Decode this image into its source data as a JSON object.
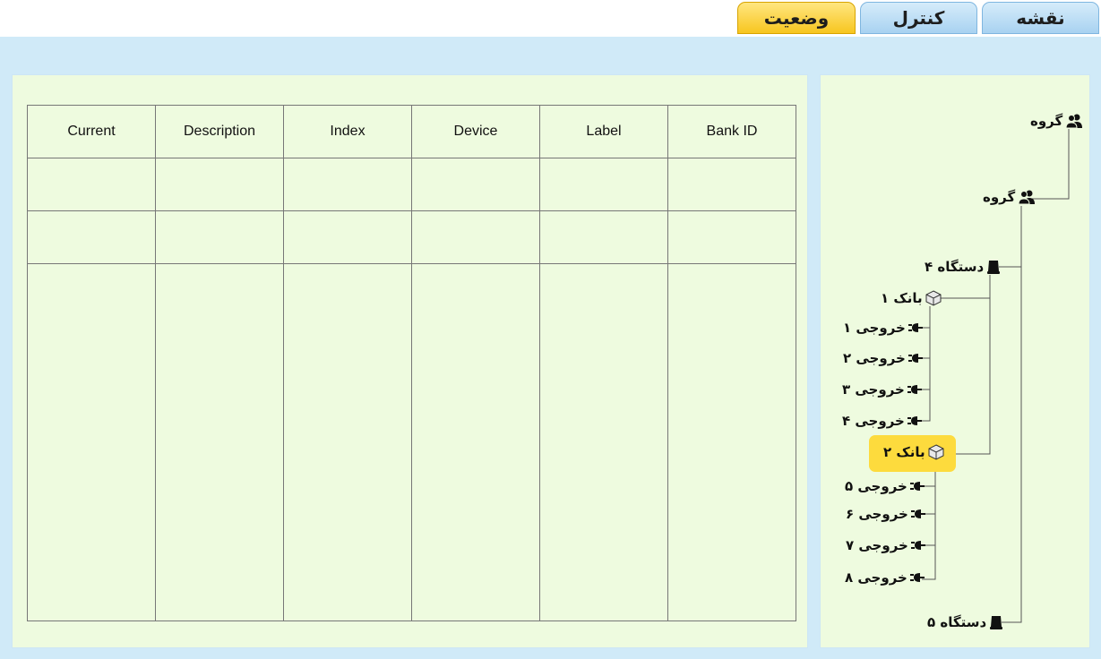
{
  "tabs": [
    {
      "label": "نقشه",
      "active": false
    },
    {
      "label": "کنترل",
      "active": false
    },
    {
      "label": "وضعیت",
      "active": true
    }
  ],
  "table": {
    "headers": [
      "Current",
      "Description",
      "Index",
      "Device",
      "Label",
      "Bank ID"
    ],
    "rows": [
      [
        "",
        "",
        "",
        "",
        "",
        ""
      ],
      [
        "",
        "",
        "",
        "",
        "",
        ""
      ],
      [
        "",
        "",
        "",
        "",
        "",
        ""
      ]
    ]
  },
  "tree": {
    "group1": {
      "label": "گروه",
      "icon": "users-icon"
    },
    "group2": {
      "label": "گروه",
      "icon": "users-icon"
    },
    "device4": {
      "label": "دستگاه ۴",
      "icon": "device-icon"
    },
    "bank1": {
      "label": "بانک ۱",
      "icon": "box-icon"
    },
    "out1": {
      "label": "خروجی ۱",
      "icon": "plug-icon"
    },
    "out2": {
      "label": "خروجی ۲",
      "icon": "plug-icon"
    },
    "out3": {
      "label": "خروجی ۳",
      "icon": "plug-icon"
    },
    "out4": {
      "label": "خروجی ۴",
      "icon": "plug-icon"
    },
    "bank2": {
      "label": "بانک ۲",
      "icon": "box-icon",
      "selected": true
    },
    "out5": {
      "label": "خروجی ۵",
      "icon": "plug-icon"
    },
    "out6": {
      "label": "خروجی ۶",
      "icon": "plug-icon"
    },
    "out7": {
      "label": "خروجی ۷",
      "icon": "plug-icon"
    },
    "out8": {
      "label": "خروجی ۸",
      "icon": "plug-icon"
    },
    "device5": {
      "label": "دستگاه ۵",
      "icon": "device-icon"
    }
  },
  "colors": {
    "background": "#d0eaf8",
    "panel": "#eefbdf",
    "tab_blue": "#bde0f7",
    "tab_active": "#fbd23a",
    "selection": "#fddb3d"
  }
}
